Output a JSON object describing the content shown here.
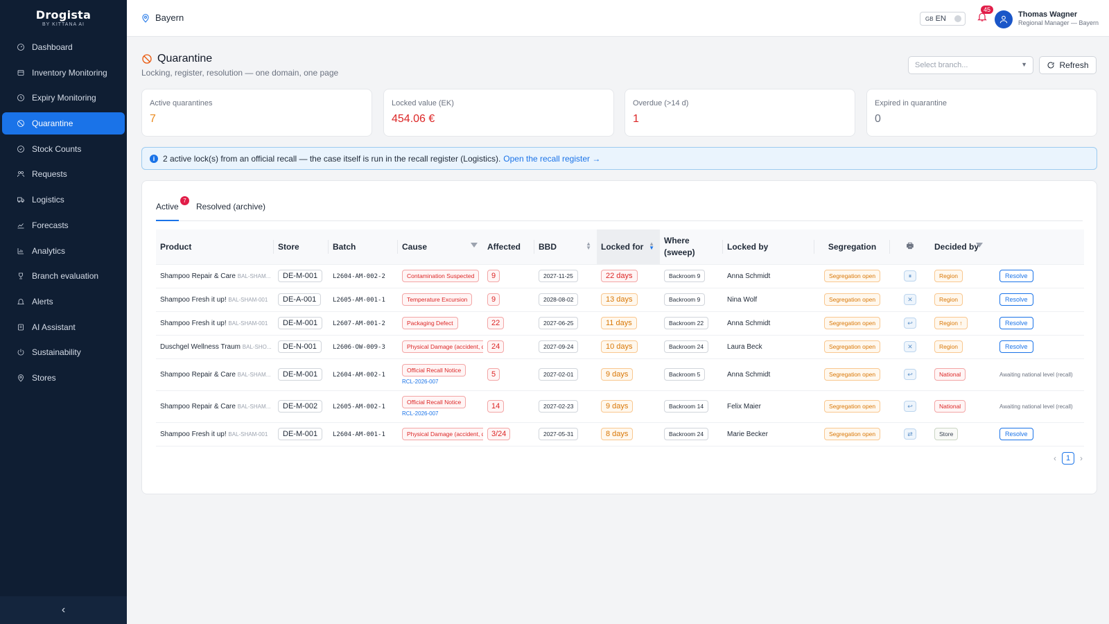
{
  "brand": {
    "name": "Drogista",
    "sub": "BY KITTANA AI"
  },
  "sidebar": {
    "items": [
      {
        "label": "Dashboard",
        "icon": "dashboard-icon"
      },
      {
        "label": "Inventory Monitoring",
        "icon": "box-icon"
      },
      {
        "label": "Expiry Monitoring",
        "icon": "clock-icon"
      },
      {
        "label": "Quarantine",
        "icon": "ban-icon",
        "active": true
      },
      {
        "label": "Stock Counts",
        "icon": "clipboard-icon"
      },
      {
        "label": "Requests",
        "icon": "people-icon"
      },
      {
        "label": "Logistics",
        "icon": "truck-icon"
      },
      {
        "label": "Forecasts",
        "icon": "trend-icon"
      },
      {
        "label": "Analytics",
        "icon": "bar-chart-icon"
      },
      {
        "label": "Branch evaluation",
        "icon": "trophy-icon"
      },
      {
        "label": "Alerts",
        "icon": "bell-icon"
      },
      {
        "label": "AI Assistant",
        "icon": "sparkle-icon"
      },
      {
        "label": "Sustainability",
        "icon": "leaf-icon"
      },
      {
        "label": "Stores",
        "icon": "pin-icon"
      }
    ],
    "collapse_label": "‹"
  },
  "topbar": {
    "location": "Bayern",
    "lang_flag": "GB",
    "lang": "EN",
    "notifications": "45",
    "user_name": "Thomas Wagner",
    "user_role": "Regional Manager — Bayern"
  },
  "header": {
    "title": "Quarantine",
    "subtitle": "Locking, register, resolution — one domain, one page",
    "branch_placeholder": "Select branch...",
    "refresh_label": "Refresh"
  },
  "stats": [
    {
      "label": "Active quarantines",
      "value": "7",
      "color": "#ea8a1e"
    },
    {
      "label": "Locked value (EK)",
      "value": "454.06 €",
      "color": "#dc2626"
    },
    {
      "label": "Overdue (>14 d)",
      "value": "1",
      "color": "#dc2626"
    },
    {
      "label": "Expired in quarantine",
      "value": "0",
      "color": "#6b7280"
    }
  ],
  "alert": {
    "text": "2 active lock(s) from an official recall — the case itself is run in the recall register (Logistics).",
    "link": "Open the recall register →"
  },
  "tabs": {
    "active": "Active",
    "active_count": "7",
    "archive": "Resolved (archive)"
  },
  "table": {
    "headers": {
      "product": "Product",
      "store": "Store",
      "batch": "Batch",
      "cause": "Cause",
      "affected": "Affected",
      "bbd": "BBD",
      "locked_for": "Locked for",
      "where": "Where (sweep)",
      "locked_by": "Locked by",
      "segregation": "Segregation",
      "decided_by": "Decided by"
    },
    "rows": [
      {
        "product": "Shampoo Repair & Care",
        "sku": "BAL-SHAM...",
        "store": "DE-M-001",
        "batch": "L2604-AM-002-2",
        "cause": "Contamination Suspected",
        "cause_style": "red",
        "recall_ref": "",
        "affected": "9",
        "bbd": "2027-11-25",
        "locked_for": "22 days",
        "days_style": "red",
        "where": "Backroom 9",
        "locked_by": "Anna Schmidt",
        "segregation": "Segregation open",
        "sym": "⏸",
        "decided_by": "Region",
        "decided_style": "orange",
        "action": "Resolve",
        "height": "h34"
      },
      {
        "product": "Shampoo Fresh it up!",
        "sku": "BAL-SHAM-001",
        "store": "DE-A-001",
        "batch": "L2605-AM-001-1",
        "cause": "Temperature Excursion",
        "cause_style": "red",
        "recall_ref": "",
        "affected": "9",
        "bbd": "2028-08-02",
        "locked_for": "13 days",
        "days_style": "orange",
        "where": "Backroom 9",
        "locked_by": "Nina Wolf",
        "segregation": "Segregation open",
        "sym": "✕",
        "decided_by": "Region",
        "decided_style": "orange",
        "action": "Resolve",
        "height": "h34"
      },
      {
        "product": "Shampoo Fresh it up!",
        "sku": "BAL-SHAM-001",
        "store": "DE-M-001",
        "batch": "L2607-AM-001-2",
        "cause": "Packaging Defect",
        "cause_style": "red",
        "recall_ref": "",
        "affected": "22",
        "bbd": "2027-06-25",
        "locked_for": "11 days",
        "days_style": "orange",
        "where": "Backroom 22",
        "locked_by": "Anna Schmidt",
        "segregation": "Segregation open",
        "sym": "↩",
        "decided_by": "Region ↑",
        "decided_style": "orange",
        "action": "Resolve",
        "height": "h34"
      },
      {
        "product": "Duschgel Wellness Traum",
        "sku": "BAL-SHO...",
        "store": "DE-N-001",
        "batch": "L2606-OW-009-3",
        "cause": "Physical Damage (accident, drop)",
        "cause_style": "red",
        "recall_ref": "",
        "affected": "24",
        "bbd": "2027-09-24",
        "locked_for": "10 days",
        "days_style": "orange",
        "where": "Backroom 24",
        "locked_by": "Laura Beck",
        "segregation": "Segregation open",
        "sym": "✕",
        "decided_by": "Region",
        "decided_style": "orange",
        "action": "Resolve",
        "height": "h34"
      },
      {
        "product": "Shampoo Repair & Care",
        "sku": "BAL-SHAM...",
        "store": "DE-M-001",
        "batch": "L2604-AM-002-1",
        "cause": "Official Recall Notice",
        "cause_style": "red",
        "recall_ref": "RCL-2026-007",
        "affected": "5",
        "bbd": "2027-02-01",
        "locked_for": "9 days",
        "days_style": "orange",
        "where": "Backroom 5",
        "locked_by": "Anna Schmidt",
        "segregation": "Segregation open",
        "sym": "↩",
        "decided_by": "National",
        "decided_style": "red",
        "action": "",
        "await": "Awaiting national level (recall)",
        "height": "h46"
      },
      {
        "product": "Shampoo Repair & Care",
        "sku": "BAL-SHAM...",
        "store": "DE-M-002",
        "batch": "L2605-AM-002-1",
        "cause": "Official Recall Notice",
        "cause_style": "red",
        "recall_ref": "RCL-2026-007",
        "affected": "14",
        "bbd": "2027-02-23",
        "locked_for": "9 days",
        "days_style": "orange",
        "where": "Backroom 14",
        "locked_by": "Felix Maier",
        "segregation": "Segregation open",
        "sym": "↩",
        "decided_by": "National",
        "decided_style": "red",
        "action": "",
        "await": "Awaiting national level (recall)",
        "height": "h46"
      },
      {
        "product": "Shampoo Fresh it up!",
        "sku": "BAL-SHAM-001",
        "store": "DE-M-001",
        "batch": "L2604-AM-001-1",
        "cause": "Physical Damage (accident, drop)",
        "cause_style": "red",
        "recall_ref": "",
        "affected": "3/24",
        "bbd": "2027-05-31",
        "locked_for": "8 days",
        "days_style": "orange",
        "where": "Backroom 24",
        "locked_by": "Marie Becker",
        "segregation": "Segregation open",
        "sym": "⇄",
        "decided_by": "Store",
        "decided_style": "green",
        "action": "Resolve",
        "height": "h34"
      }
    ]
  },
  "pager": {
    "prev": "‹",
    "page": "1",
    "next": "›"
  }
}
